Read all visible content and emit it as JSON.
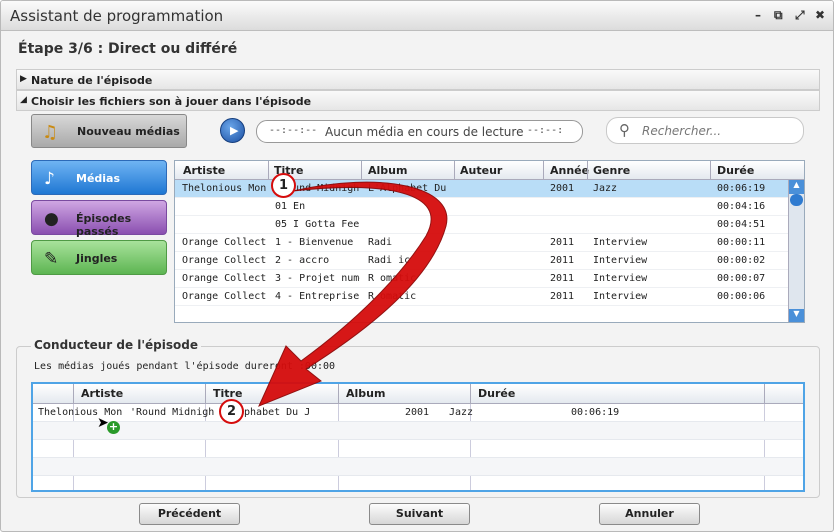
{
  "window": {
    "title": "Assistant de programmation",
    "controls": [
      "–",
      "⧉",
      "⤢",
      "✖"
    ]
  },
  "step": "Étape 3/6 : Direct ou différé",
  "accordion": [
    {
      "label": "Nature de l'épisode",
      "icon": "triangle-right-icon"
    },
    {
      "label": "Choisir les fichiers son à jouer dans l'épisode",
      "icon": "triangle-down-icon"
    }
  ],
  "toolbar": {
    "new_media": "Nouveau médias",
    "player_time_left": "--:--:--",
    "player_text": "Aucun média en cours de lecture",
    "player_time_right": "--:--:",
    "search_placeholder": "Rechercher..."
  },
  "categories": [
    {
      "label": "Médias",
      "icon": "music-note-icon"
    },
    {
      "label": "Épisodes passés",
      "icon": "microphone-icon"
    },
    {
      "label": "Jingles",
      "icon": "jingle-icon"
    }
  ],
  "media_table": {
    "columns": [
      "Artiste",
      "Titre",
      "Album",
      "Auteur",
      "Année",
      "Genre",
      "Durée"
    ],
    "rows": [
      [
        "Thelonious Mon",
        "'Round Midnigh",
        "L'Alphabet Du J",
        "",
        "2001",
        "Jazz",
        "00:06:19"
      ],
      [
        "",
        "01 En",
        "",
        "",
        "",
        "",
        "00:04:16"
      ],
      [
        "",
        "05 I Gotta Feel",
        "",
        "",
        "",
        "",
        "00:04:51"
      ],
      [
        "Orange Collecti",
        "1 - Bienvenue",
        "Radi",
        "",
        "2011",
        "Interview",
        "00:00:11"
      ],
      [
        "Orange Collecti",
        "2 - accro",
        "Radi     ic",
        "",
        "2011",
        "Interview",
        "00:00:02"
      ],
      [
        "Orange Collecti",
        "3 - Projet nume",
        "R     omatic",
        "",
        "2011",
        "Interview",
        "00:00:07"
      ],
      [
        "Orange Collecti",
        "4 - Entreprises",
        "R     omatic",
        "",
        "2011",
        "Interview",
        "00:00:06"
      ]
    ]
  },
  "conducteur": {
    "title": "Conducteur de l'épisode",
    "info": "Les médias joués pendant l'épisode dureront :00:00",
    "columns": [
      "Artiste",
      "Titre",
      "Album",
      "Durée"
    ],
    "rows": [
      [
        "Thelonious Mon",
        "'Round Midnigh",
        "lphabet Du J",
        "2001",
        "Jazz",
        "00:06:19"
      ]
    ]
  },
  "annotations": {
    "badge1": "1",
    "badge2": "2",
    "add_icon": "+"
  },
  "buttons": {
    "previous": "Précédent",
    "next": "Suivant",
    "cancel": "Annuler"
  },
  "colors": {
    "accent": "#4fa4e6",
    "selected_row": "#b9ddf7",
    "arrow": "#d50c0c"
  }
}
